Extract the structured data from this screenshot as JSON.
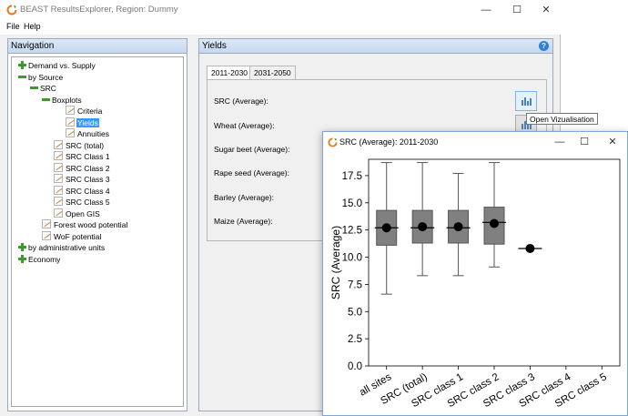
{
  "main_window": {
    "title": "BEAST ResultsExplorer, Region: Dummy",
    "controls": {
      "minimize": "—",
      "maximize": "☐",
      "close": "✕"
    }
  },
  "menu": {
    "file": "File",
    "help": "Help"
  },
  "navigation": {
    "header": "Navigation",
    "items": [
      {
        "label": "Demand vs. Supply",
        "icon": "plus-icon"
      },
      {
        "label": "by Source",
        "icon": "minus-icon"
      },
      {
        "label": "SRC",
        "icon": "minus-icon"
      },
      {
        "label": "Boxplots",
        "icon": "minus-icon"
      },
      {
        "label": "Criteria",
        "icon": "document-icon"
      },
      {
        "label": "Yields",
        "icon": "document-icon",
        "selected": true
      },
      {
        "label": "Annuities",
        "icon": "document-icon"
      },
      {
        "label": "SRC (total)",
        "icon": "document-icon"
      },
      {
        "label": "SRC Class 1",
        "icon": "document-icon"
      },
      {
        "label": "SRC Class 2",
        "icon": "document-icon"
      },
      {
        "label": "SRC Class 3",
        "icon": "document-icon"
      },
      {
        "label": "SRC Class 4",
        "icon": "document-icon"
      },
      {
        "label": "SRC Class 5",
        "icon": "document-icon"
      },
      {
        "label": "Open GIS",
        "icon": "document-icon"
      },
      {
        "label": "Forest wood potential",
        "icon": "document-icon"
      },
      {
        "label": "WoF potential",
        "icon": "document-icon"
      },
      {
        "label": "by administrative units",
        "icon": "plus-icon"
      },
      {
        "label": "Economy",
        "icon": "plus-icon"
      }
    ]
  },
  "yields": {
    "header": "Yields",
    "tabs": [
      {
        "label": "2011-2030",
        "active": true
      },
      {
        "label": "2031-2050",
        "active": false
      }
    ],
    "rows": [
      "SRC (Average):",
      "Wheat (Average):",
      "Sugar beet (Average):",
      "Rape seed (Average):",
      "Barley (Average):",
      "Maize (Average):"
    ],
    "tooltip": "Open Vizualisation"
  },
  "chart_window": {
    "title": "SRC (Average): 2011-2030",
    "controls": {
      "minimize": "—",
      "maximize": "☐",
      "close": "✕"
    }
  },
  "colors": {
    "box_fill": "#808080",
    "mean_marker": "#000000",
    "accent": "#2f7fd6",
    "selection": "#3399ff"
  },
  "chart_data": {
    "type": "boxplot",
    "title": "",
    "xlabel": "",
    "ylabel": "SRC (Average)",
    "ylim": [
      0,
      19
    ],
    "yticks": [
      "0.0",
      "2.5",
      "5.0",
      "7.5",
      "10.0",
      "12.5",
      "15.0",
      "17.5"
    ],
    "grid": false,
    "categories": [
      "all sites",
      "SRC (total)",
      "SRC class 1",
      "SRC class 2",
      "SRC class 3",
      "SRC class 4",
      "SRC class 5"
    ],
    "boxes": [
      {
        "min": 6.6,
        "q1": 11.1,
        "median": 12.7,
        "q3": 14.3,
        "max": 18.7,
        "mean": 12.7
      },
      {
        "min": 8.3,
        "q1": 11.3,
        "median": 12.7,
        "q3": 14.3,
        "max": 18.7,
        "mean": 12.8
      },
      {
        "min": 8.3,
        "q1": 11.3,
        "median": 12.7,
        "q3": 14.3,
        "max": 17.7,
        "mean": 12.8
      },
      {
        "min": 9.1,
        "q1": 11.2,
        "median": 13.2,
        "q3": 14.6,
        "max": 18.7,
        "mean": 13.1
      },
      {
        "min": 10.8,
        "q1": 10.8,
        "median": 10.8,
        "q3": 10.8,
        "max": 10.8,
        "mean": 10.8
      },
      null,
      null
    ]
  }
}
